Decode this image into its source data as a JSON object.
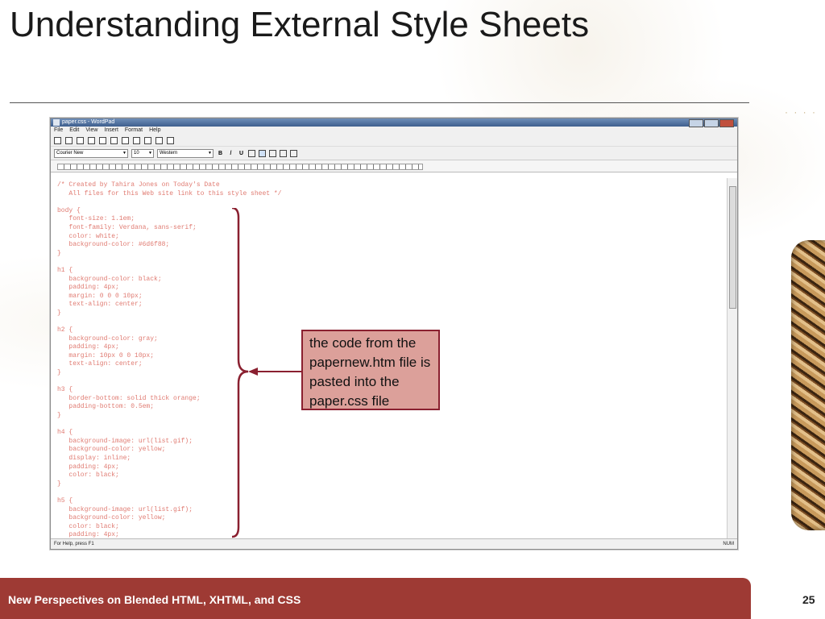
{
  "slide": {
    "title": "Understanding External Style Sheets",
    "footer": "New Perspectives on Blended HTML, XHTML, and CSS",
    "page_number": "25"
  },
  "window": {
    "title": "paper.css - WordPad",
    "menu": [
      "File",
      "Edit",
      "View",
      "Insert",
      "Format",
      "Help"
    ],
    "font_name": "Courier New",
    "font_size": "10",
    "script": "Western",
    "format_buttons": [
      "B",
      "/",
      "U"
    ],
    "status_left": "For Help, press F1",
    "status_right": "NUM",
    "code": "/* Created by Tahira Jones on Today's Date\n   All files for this Web site link to this style sheet */\n\nbody {\n   font-size: 1.1em;\n   font-family: Verdana, sans-serif;\n   color: white;\n   background-color: #6d6f88;\n}\n\nh1 {\n   background-color: black;\n   padding: 4px;\n   margin: 0 0 0 10px;\n   text-align: center;\n}\n\nh2 {\n   background-color: gray;\n   padding: 4px;\n   margin: 10px 0 0 10px;\n   text-align: center;\n}\n\nh3 {\n   border-bottom: solid thick orange;\n   padding-bottom: 0.5em;\n}\n\nh4 {\n   background-image: url(list.gif);\n   background-color: yellow;\n   display: inline;\n   padding: 4px;\n   color: black;\n}\n\nh5 {\n   background-image: url(list.gif);\n   background-color: yellow;\n   color: black;\n   padding: 4px;"
  },
  "callout": {
    "text": "the code from the papernew.htm file is pasted into the paper.css file"
  },
  "colors": {
    "footer_bar": "#9e3a34",
    "callout_fill": "#dca09a",
    "callout_border": "#8a2030",
    "code_text": "#e07b72"
  }
}
